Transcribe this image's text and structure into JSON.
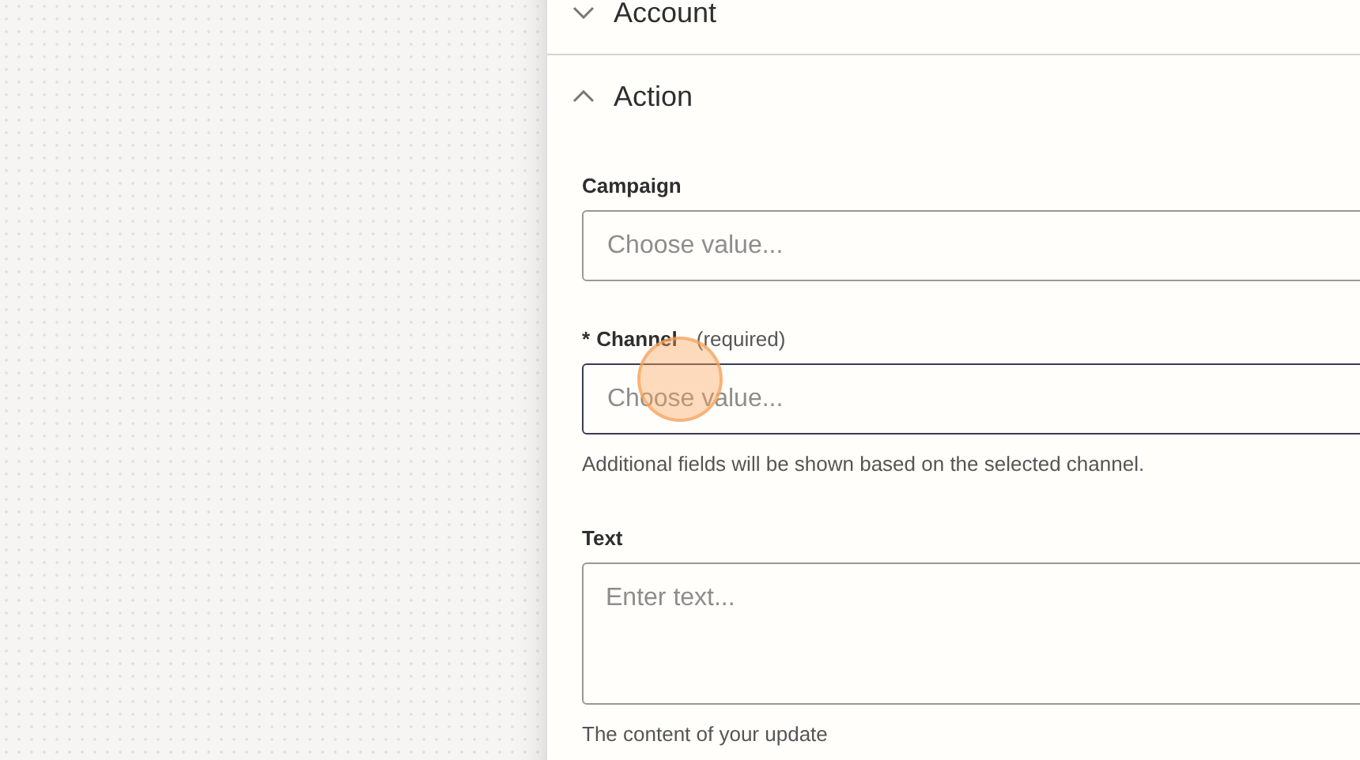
{
  "sections": [
    {
      "title": "Account",
      "expanded": false
    },
    {
      "title": "Action",
      "expanded": true,
      "fields": [
        {
          "kind": "select",
          "label": "Campaign",
          "placeholder": "Choose value...",
          "focused": false
        },
        {
          "kind": "select",
          "label": "Channel",
          "required_mark": "*",
          "required_note": "(required)",
          "placeholder": "Choose value...",
          "focused": true,
          "help": "Additional fields will be shown based on the selected channel."
        },
        {
          "kind": "textarea",
          "label": "Text",
          "placeholder": "Enter text...",
          "focused": false,
          "help": "The content of your update"
        }
      ]
    }
  ]
}
